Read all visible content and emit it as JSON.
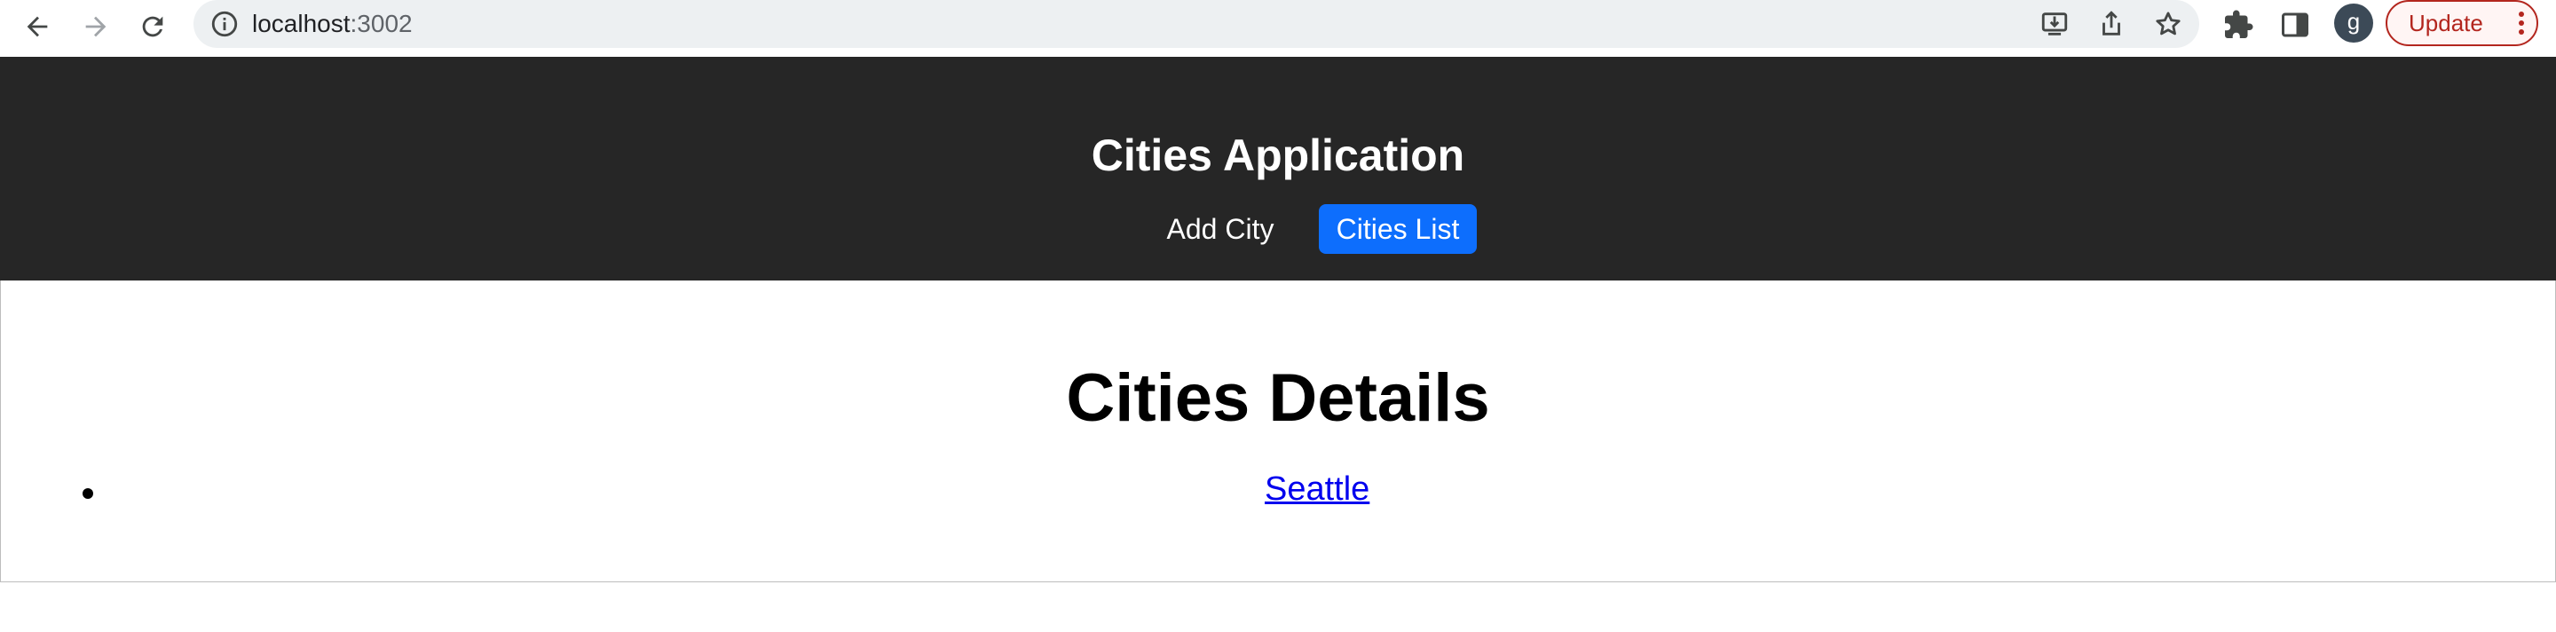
{
  "browser": {
    "url_host": "localhost",
    "url_port": ":3002",
    "profile_initial": "g",
    "update_label": "Update"
  },
  "app": {
    "title": "Cities Application",
    "nav": [
      {
        "label": "Add City",
        "active": false
      },
      {
        "label": "Cities List",
        "active": true
      }
    ],
    "accent_color": "#0d6efd",
    "header_color": "#262626"
  },
  "page": {
    "title": "Cities Details",
    "cities": [
      {
        "name": "Seattle"
      }
    ]
  },
  "icons": {
    "back": "arrow-left-icon",
    "forward": "arrow-right-icon",
    "reload": "reload-icon",
    "site_info": "info-icon",
    "install": "install-icon",
    "share": "share-icon",
    "bookmark": "star-icon",
    "extensions": "puzzle-icon",
    "side_panel": "side-panel-icon",
    "menu": "kebab-menu-icon"
  }
}
